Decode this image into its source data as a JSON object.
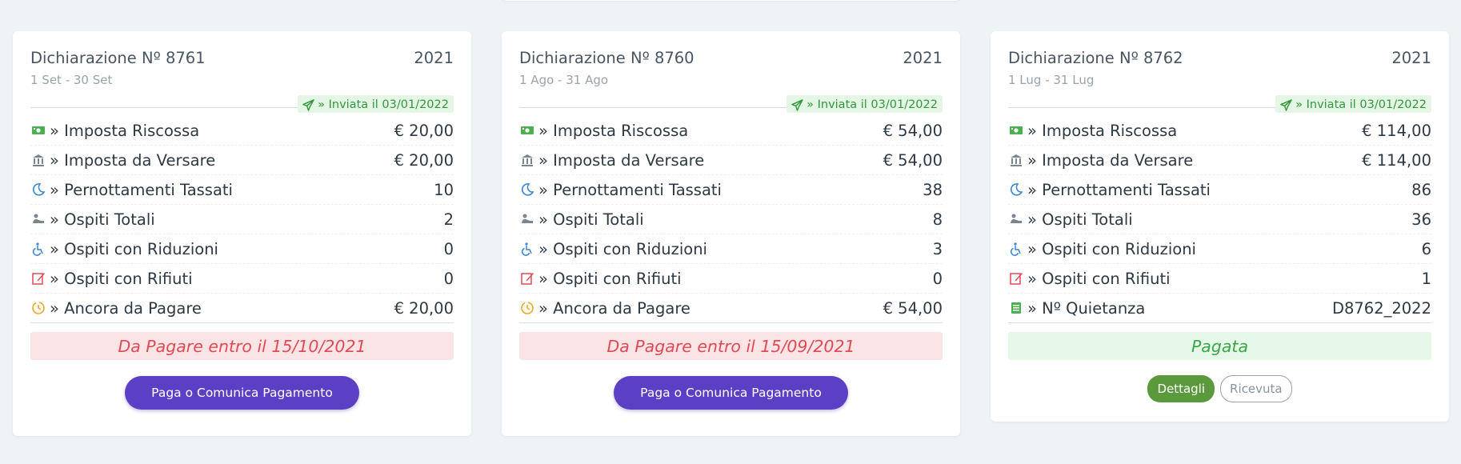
{
  "cards": [
    {
      "title": "Dichiarazione Nº 8761",
      "period": "1 Set - 30 Set",
      "year": "2021",
      "sent_label": "» Inviata il 03/01/2022",
      "rows": [
        {
          "icon": "money-icon",
          "label": "» Imposta Riscossa",
          "value": "€ 20,00"
        },
        {
          "icon": "bank-icon",
          "label": "» Imposta da Versare",
          "value": "€ 20,00"
        },
        {
          "icon": "moon-icon",
          "label": "» Pernottamenti Tassati",
          "value": "10"
        },
        {
          "icon": "guests-icon",
          "label": "» Ospiti Totali",
          "value": "2"
        },
        {
          "icon": "wheelchair-icon",
          "label": "» Ospiti con Riduzioni",
          "value": "0"
        },
        {
          "icon": "edit-icon",
          "label": "» Ospiti con Rifiuti",
          "value": "0"
        },
        {
          "icon": "clock-icon",
          "label": "» Ancora da Pagare",
          "value": "€ 20,00"
        }
      ],
      "status": "Da Pagare entro il 15/10/2021",
      "button": "Paga o Comunica Pagamento"
    },
    {
      "title": "Dichiarazione Nº 8760",
      "period": "1 Ago - 31 Ago",
      "year": "2021",
      "sent_label": "» Inviata il 03/01/2022",
      "rows": [
        {
          "icon": "money-icon",
          "label": "» Imposta Riscossa",
          "value": "€ 54,00"
        },
        {
          "icon": "bank-icon",
          "label": "» Imposta da Versare",
          "value": "€ 54,00"
        },
        {
          "icon": "moon-icon",
          "label": "» Pernottamenti Tassati",
          "value": "38"
        },
        {
          "icon": "guests-icon",
          "label": "» Ospiti Totali",
          "value": "8"
        },
        {
          "icon": "wheelchair-icon",
          "label": "» Ospiti con Riduzioni",
          "value": "3"
        },
        {
          "icon": "edit-icon",
          "label": "» Ospiti con Rifiuti",
          "value": "0"
        },
        {
          "icon": "clock-icon",
          "label": "» Ancora da Pagare",
          "value": "€ 54,00"
        }
      ],
      "status": "Da Pagare entro il 15/09/2021",
      "button": "Paga o Comunica Pagamento"
    },
    {
      "title": "Dichiarazione Nº 8762",
      "period": "1 Lug - 31 Lug",
      "year": "2021",
      "sent_label": "» Inviata il 03/01/2022",
      "rows": [
        {
          "icon": "money-icon",
          "label": "» Imposta Riscossa",
          "value": "€ 114,00"
        },
        {
          "icon": "bank-icon",
          "label": "» Imposta da Versare",
          "value": "€ 114,00"
        },
        {
          "icon": "moon-icon",
          "label": "» Pernottamenti Tassati",
          "value": "86"
        },
        {
          "icon": "guests-icon",
          "label": "» Ospiti Totali",
          "value": "36"
        },
        {
          "icon": "wheelchair-icon",
          "label": "» Ospiti con Riduzioni",
          "value": "6"
        },
        {
          "icon": "edit-icon",
          "label": "» Ospiti con Rifiuti",
          "value": "1"
        },
        {
          "icon": "receipt-icon",
          "label": "» Nº Quietanza",
          "value": "D8762_2022"
        }
      ],
      "status": "Pagata",
      "details_button": "Dettagli",
      "receipt_button": "Ricevuta"
    }
  ],
  "colors": {
    "sent_green": "#2f9a3a",
    "due_red": "#e04a55",
    "paid_green": "#3aa647",
    "primary_purple": "#5b3fc4",
    "details_green": "#5a9a3d"
  }
}
